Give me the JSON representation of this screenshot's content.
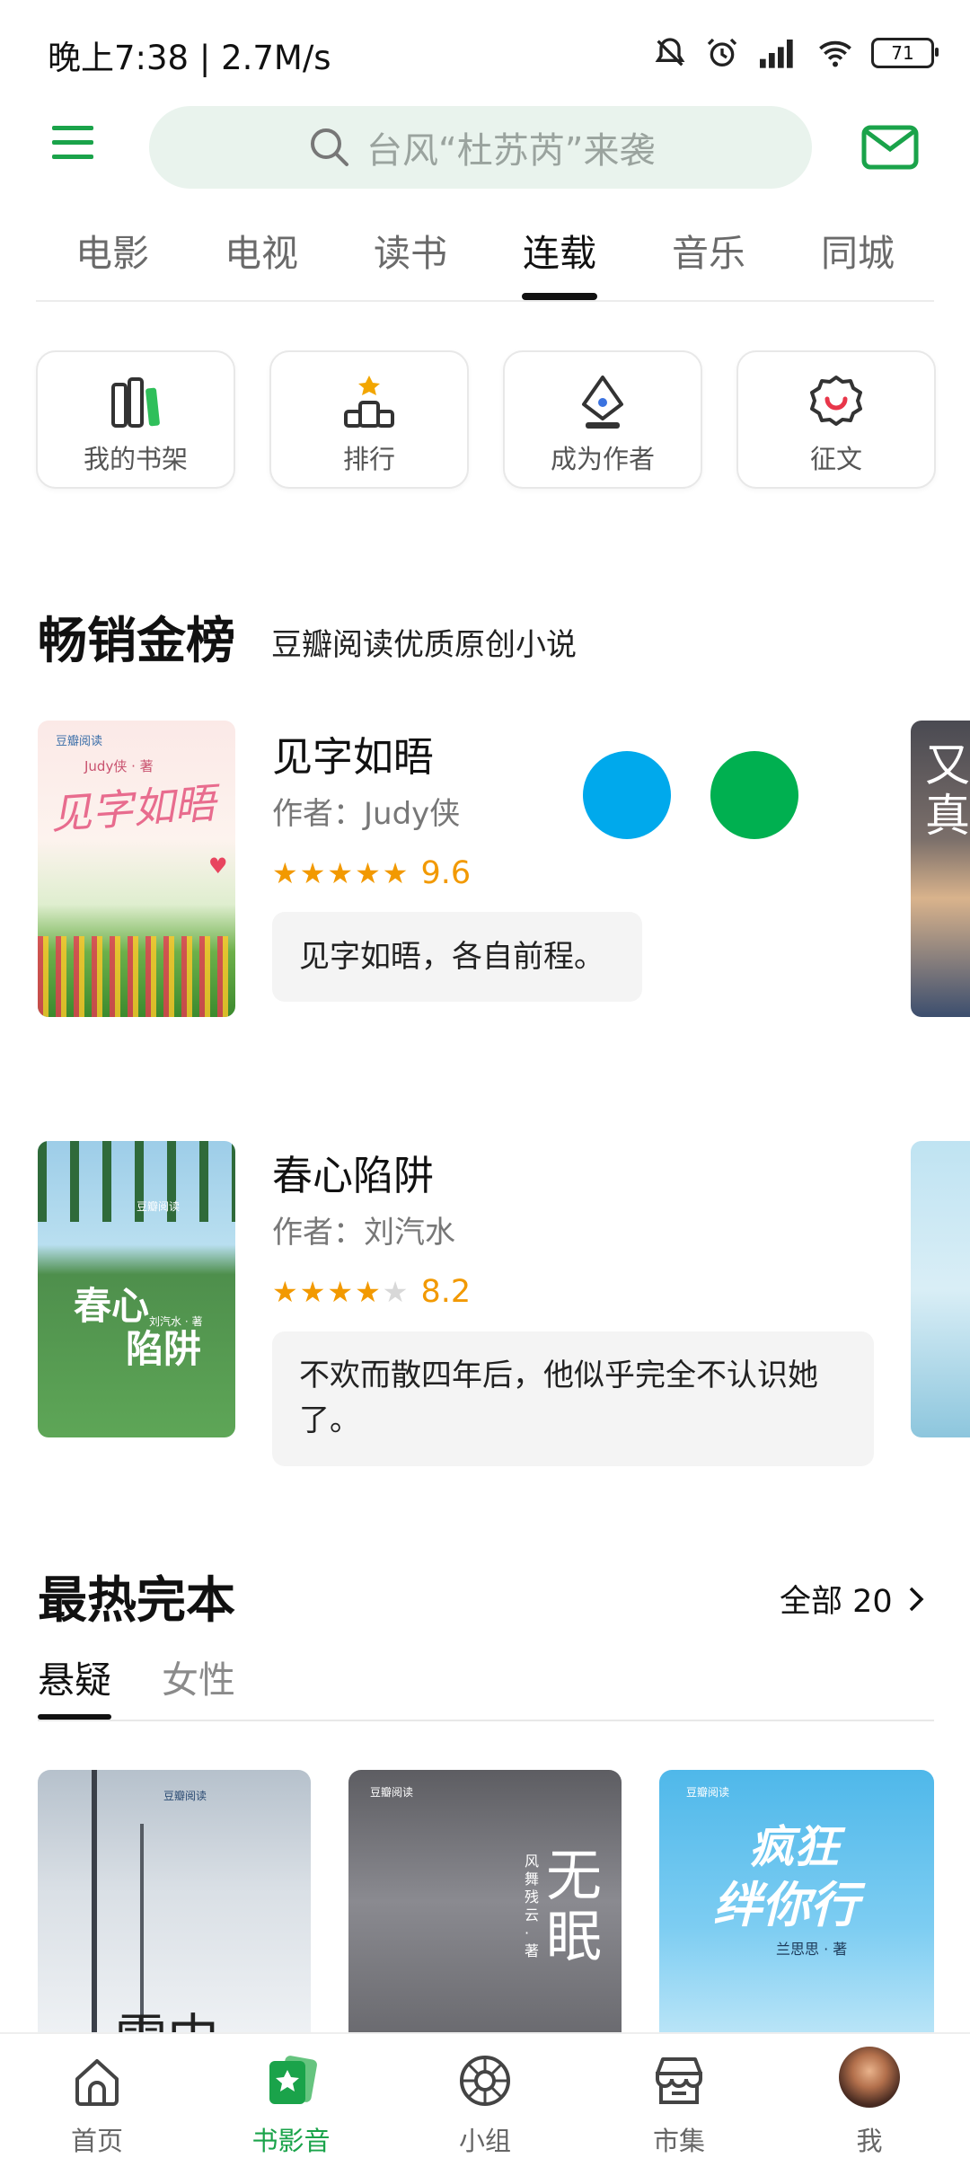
{
  "status_bar": {
    "time": "晚上7:38 | 2.7M/s",
    "battery": "71"
  },
  "header": {
    "search_placeholder": "台风“杜苏芮”来袭",
    "icons": [
      "menu-icon",
      "search-icon",
      "mail-icon"
    ],
    "accent": "#1aa34a"
  },
  "top_tabs": [
    {
      "label": "电影"
    },
    {
      "label": "电视"
    },
    {
      "label": "读书"
    },
    {
      "label": "连载",
      "active": true
    },
    {
      "label": "音乐"
    },
    {
      "label": "同城"
    }
  ],
  "tiles": [
    {
      "label": "我的书架",
      "icon": "bookshelf-icon"
    },
    {
      "label": "排行",
      "icon": "podium-icon"
    },
    {
      "label": "成为作者",
      "icon": "pen-nib-icon"
    },
    {
      "label": "征文",
      "icon": "badge-icon"
    }
  ],
  "bestseller": {
    "title": "畅销金榜",
    "subtitle": "豆瓣阅读优质原创小说",
    "books": [
      {
        "title": "见字如晤",
        "author": "作者：Judy侠",
        "rating": 9.6,
        "rating_text": "9.6",
        "stars": 5,
        "quote": "见字如晤，各自前程。",
        "cover_publisher": "豆瓣阅读",
        "cover_byline": "Judy侠 · 著",
        "cover_title": "见字如晤"
      },
      {
        "title": "春心陷阱",
        "author": "作者：刘汽水",
        "rating": 8.2,
        "rating_text": "8.2",
        "stars": 4,
        "quote": "不欢而散四年后，他似乎完全不认识她了。",
        "cover_publisher": "豆瓣阅读",
        "cover_byline": "刘汽水 · 著",
        "cover_title_1": "春心",
        "cover_title_2": "陷阱"
      }
    ],
    "peek_cover_text": "又真",
    "bubble_colors": [
      "#00a9ec",
      "#00b050"
    ]
  },
  "hot_complete": {
    "title": "最热完本",
    "see_all": "全部 20",
    "subtabs": [
      {
        "label": "悬疑",
        "active": true
      },
      {
        "label": "女性"
      }
    ],
    "covers": [
      {
        "publisher": "豆瓣阅读",
        "title": "雪中"
      },
      {
        "publisher": "豆瓣阅读",
        "title": "无眠",
        "byline": "风舞残云 · 著"
      },
      {
        "publisher": "豆瓣阅读",
        "title_1": "疯狂",
        "title_2": "绊你行",
        "byline": "兰思思 · 著"
      }
    ]
  },
  "bottom_nav": [
    {
      "label": "首页",
      "icon": "home-icon"
    },
    {
      "label": "书影音",
      "icon": "media-icon",
      "active": true
    },
    {
      "label": "小组",
      "icon": "group-icon"
    },
    {
      "label": "市集",
      "icon": "market-icon"
    },
    {
      "label": "我",
      "icon": "avatar"
    }
  ]
}
